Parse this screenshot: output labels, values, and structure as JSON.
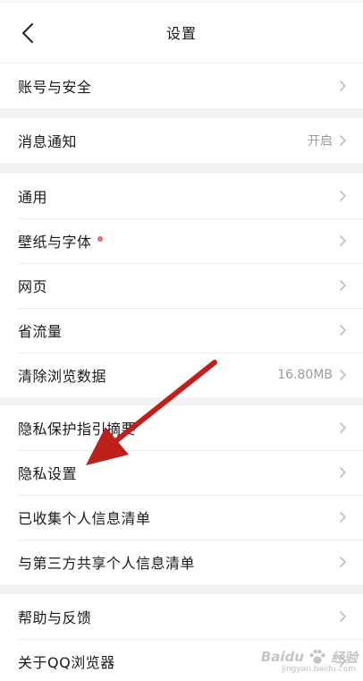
{
  "header": {
    "title": "设置"
  },
  "groups": [
    {
      "rows": [
        {
          "label": "账号与安全"
        }
      ]
    },
    {
      "rows": [
        {
          "label": "消息通知",
          "value": "开启"
        }
      ]
    },
    {
      "rows": [
        {
          "label": "通用"
        },
        {
          "label": "壁纸与字体",
          "badge": "red-dot"
        },
        {
          "label": "网页"
        },
        {
          "label": "省流量"
        },
        {
          "label": "清除浏览数据",
          "value": "16.80MB"
        }
      ]
    },
    {
      "rows": [
        {
          "label": "隐私保护指引摘要"
        },
        {
          "label": "隐私设置"
        },
        {
          "label": "已收集个人信息清单"
        },
        {
          "label": "与第三方共享个人信息清单"
        }
      ]
    },
    {
      "rows": [
        {
          "label": "帮助与反馈"
        },
        {
          "label": "关于QQ浏览器"
        }
      ]
    }
  ],
  "annotation": {
    "color": "#c0201b",
    "points_to": "隐私设置"
  },
  "watermark": {
    "brand": "Baidu",
    "text": "经验",
    "sub": "jingyan.baidu.com"
  },
  "colors": {
    "background": "#f2f2f2",
    "row_bg": "#ffffff",
    "value_text": "#9a9a9a",
    "badge": "#e96a6a"
  }
}
